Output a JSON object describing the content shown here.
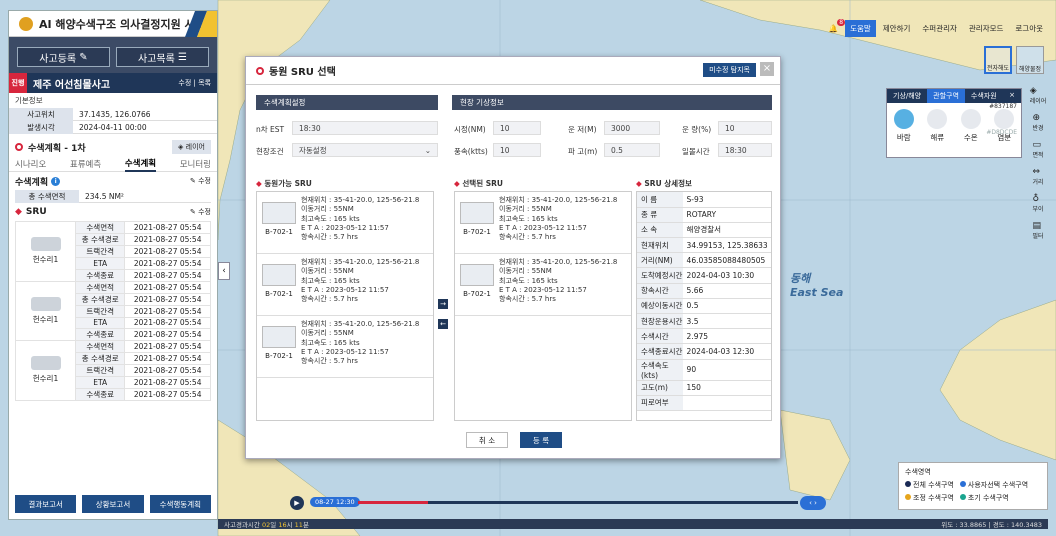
{
  "app": {
    "title": "AI 해양수색구조 의사결정지원 시스템"
  },
  "left": {
    "btn_register": "사고등록",
    "btn_list": "사고목록",
    "incident": {
      "tag": "진행",
      "name": "제주 어선침몰사고",
      "edit": "수정",
      "sep": "|",
      "list": "목록"
    },
    "basic_info": "기본정보",
    "info": [
      {
        "k": "사고위치",
        "v": "37.1435, 126.0766"
      },
      {
        "k": "발생시각",
        "v": "2024-04-11  00:00"
      }
    ],
    "plan_title": "수색계획 - 1차",
    "layer_btn": "레이어",
    "tabs": [
      "시나리오",
      "표류예측",
      "수색계획",
      "모니터링"
    ],
    "plan_section": "수색계획",
    "plan_edit": "수정",
    "area": {
      "k": "총 수색면적",
      "v": "234.5 NM²"
    },
    "sru_section": "SRU",
    "sru_edit": "수정",
    "sru_groups": [
      {
        "name": "헌수리1",
        "rows": [
          [
            "수색면적",
            "2021-08-27 05:54"
          ],
          [
            "총 수색경로",
            "2021-08-27 05:54"
          ],
          [
            "트랙간격",
            "2021-08-27 05:54"
          ],
          [
            "ETA",
            "2021-08-27 05:54"
          ],
          [
            "수색종료",
            "2021-08-27 05:54"
          ]
        ]
      },
      {
        "name": "헌수리1",
        "rows": [
          [
            "수색면적",
            "2021-08-27 05:54"
          ],
          [
            "총 수색경로",
            "2021-08-27 05:54"
          ],
          [
            "트랙간격",
            "2021-08-27 05:54"
          ],
          [
            "ETA",
            "2021-08-27 05:54"
          ],
          [
            "수색종료",
            "2021-08-27 05:54"
          ]
        ]
      },
      {
        "name": "헌수리1",
        "rows": [
          [
            "수색면적",
            "2021-08-27 05:54"
          ],
          [
            "총 수색경로",
            "2021-08-27 05:54"
          ],
          [
            "트랙간격",
            "2021-08-27 05:54"
          ],
          [
            "ETA",
            "2021-08-27 05:54"
          ],
          [
            "수색종료",
            "2021-08-27 05:54"
          ]
        ]
      }
    ],
    "bottom": [
      "결과보고서",
      "상황보고서",
      "수색행동계획"
    ]
  },
  "dialog": {
    "title": "동원 SRU 선택",
    "pill": "미수정 탐지목",
    "close": "×",
    "plan_setting": "수색계획설정",
    "weather": "현장 기상정보",
    "est_label": "n차 EST",
    "est_value": "18:30",
    "cond_label": "현장조건",
    "cond_value": "자동설정",
    "vis_label": "시정(NM)",
    "vis_value": "10",
    "wind_label": "풍속(ktts)",
    "wind_value": "10",
    "ceil_label": "운 저(M)",
    "ceil_value": "3000",
    "wave_label": "파 고(m)",
    "wave_value": "0.5",
    "cloud_label": "운 량(%)",
    "cloud_value": "10",
    "sunset_label": "일몰시간",
    "sunset_value": "18:30",
    "avail_title": "동원가능 SRU",
    "sel_title": "선택된 SRU",
    "detail_title": "SRU 상세정보",
    "avail": [
      {
        "id": "B-702-1",
        "l1": "현재위치 : 35-41-20.0, 125-56-21.8",
        "l2": "이동거리 : 55NM",
        "l3": "최고속도 : 165 kts",
        "l4": "E T A : 2023-05-12 11:57",
        "l5": "항속시간 : 5.7 hrs"
      },
      {
        "id": "B-702-1",
        "l1": "현재위치 : 35-41-20.0, 125-56-21.8",
        "l2": "이동거리 : 55NM",
        "l3": "최고속도 : 165 kts",
        "l4": "E T A : 2023-05-12 11:57",
        "l5": "항속시간 : 5.7 hrs"
      },
      {
        "id": "B-702-1",
        "l1": "현재위치 : 35-41-20.0, 125-56-21.8",
        "l2": "이동거리 : 55NM",
        "l3": "최고속도 : 165 kts",
        "l4": "E T A : 2023-05-12 11:57",
        "l5": "항속시간 : 5.7 hrs"
      }
    ],
    "selected": [
      {
        "id": "B-702-1",
        "l1": "현재위치 : 35-41-20.0, 125-56-21.8",
        "l2": "이동거리 : 55NM",
        "l3": "최고속도 : 165 kts",
        "l4": "E T A : 2023-05-12 11:57",
        "l5": "항속시간 : 5.7 hrs"
      },
      {
        "id": "B-702-1",
        "l1": "현재위치 : 35-41-20.0, 125-56-21.8",
        "l2": "이동거리 : 55NM",
        "l3": "최고속도 : 165 kts",
        "l4": "E T A : 2023-05-12 11:57",
        "l5": "항속시간 : 5.7 hrs"
      }
    ],
    "detail": [
      [
        "이    름",
        "S-93"
      ],
      [
        "종    류",
        "ROTARY"
      ],
      [
        "소    속",
        "해양경찰서"
      ],
      [
        "현재위치",
        "34.99153, 125.38633"
      ],
      [
        "거리(NM)",
        "46.03585088480505"
      ],
      [
        "도착예정시간",
        "2024-04-03  10:30"
      ],
      [
        "항속시간",
        "5.66"
      ],
      [
        "예상이동시간",
        "0.5"
      ],
      [
        "현장운용시간",
        "3.5"
      ],
      [
        "수색시간",
        "2.975"
      ],
      [
        "수색종료시간",
        "2024-04-03  12:30"
      ],
      [
        "수색속도(kts)",
        "90"
      ],
      [
        "고도(m)",
        "150"
      ],
      [
        "피로여부",
        ""
      ]
    ],
    "cancel": "취  소",
    "confirm": "등  록"
  },
  "topnav": [
    "도움말",
    "제안하기",
    "수퍼관리자",
    "관리자모드",
    "로그아웃"
  ],
  "alert_count": "8",
  "map_types": [
    "전자해도",
    "해양물정"
  ],
  "weather_panel": {
    "tabs": [
      "기상/해양",
      "관할구역",
      "수색자원"
    ],
    "code": "#837187",
    "code2": "#D8DCDE",
    "items": [
      "바람",
      "해류",
      "수온",
      "염분"
    ]
  },
  "rtools": [
    "레이어",
    "반경",
    "면적",
    "거리",
    "부이",
    "필터"
  ],
  "map_labels": {
    "east_sea_ko": "동해",
    "east_sea_en": "East Sea"
  },
  "legend": {
    "title": "수색영역",
    "items": [
      {
        "label": "전체 수색구역",
        "color": "#1a2a55"
      },
      {
        "label": "사용자선택 수색구역",
        "color": "#2a6fd6"
      },
      {
        "label": "조정 수색구역",
        "color": "#e6a51c"
      },
      {
        "label": "초기 수색구역",
        "color": "#1aa58f"
      }
    ]
  },
  "timebar": {
    "time": "08-27 12:30"
  },
  "status": {
    "left_label": "사고경과시간",
    "days": "02",
    "h": "16",
    "m": "11",
    "dlabel": "일",
    "hlabel": "시",
    "mlabel": "분",
    "right": "위도 : 33.8865  |  경도 : 140.3483"
  }
}
